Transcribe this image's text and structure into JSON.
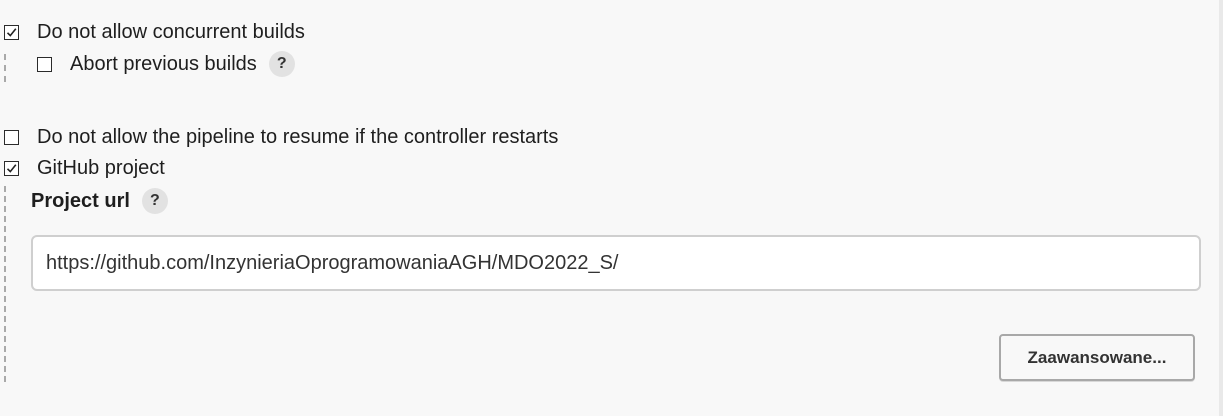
{
  "options": {
    "no_concurrent": {
      "label": "Do not allow concurrent builds",
      "checked": true
    },
    "abort_previous": {
      "label": "Abort previous builds",
      "checked": false,
      "help": "?"
    },
    "no_resume": {
      "label": "Do not allow the pipeline to resume if the controller restarts",
      "checked": false
    },
    "github_project": {
      "label": "GitHub project",
      "checked": true
    }
  },
  "project_url": {
    "label": "Project url",
    "help": "?",
    "value": "https://github.com/InzynieriaOprogramowaniaAGH/MDO2022_S/"
  },
  "advanced_button": {
    "label": "Zaawansowane..."
  },
  "icons": {
    "checkmark": "checkmark-icon",
    "help": "help-icon"
  }
}
